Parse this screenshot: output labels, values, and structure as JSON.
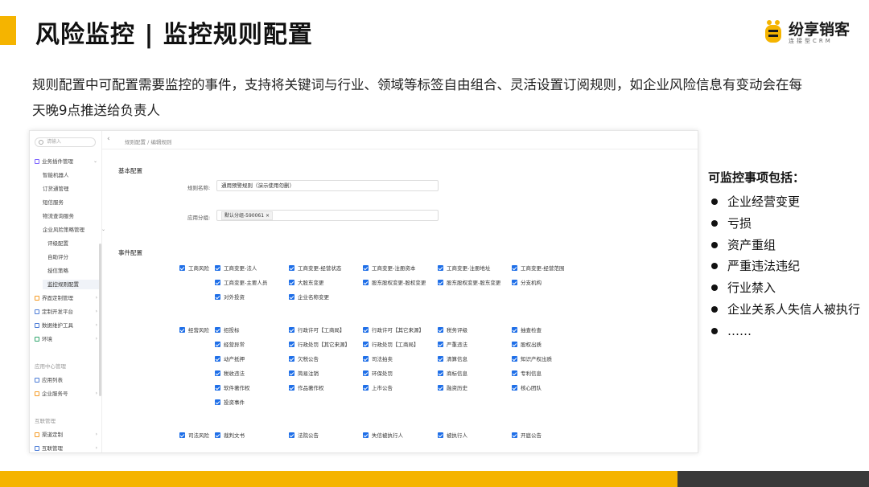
{
  "slide": {
    "title": "风险监控 | 监控规则配置",
    "description": "规则配置中可配置需要监控的事件，支持将关键词与行业、领域等标签自由组合、灵活设置订阅规则，如企业风险信息有变动会在每天晚9点推送给负责人"
  },
  "logo": {
    "name": "纷享销客",
    "sub": "连接型CRM"
  },
  "app": {
    "search_placeholder": "请输入",
    "breadcrumb": "规则配置 / 编辑规则",
    "sidebar": [
      {
        "label": "业务插件管理",
        "icon": "plugin-icon",
        "color": "#7b61ff"
      },
      {
        "label": "智能机器人"
      },
      {
        "label": "订货通管理"
      },
      {
        "label": "短信服务"
      },
      {
        "label": "物流查询服务"
      },
      {
        "label": "企业风险策略管理"
      },
      {
        "label": "评级配置"
      },
      {
        "label": "自助评分"
      },
      {
        "label": "授信策略"
      },
      {
        "label": "监控规则配置"
      },
      {
        "label": "界面定制管理",
        "icon": "layout-icon",
        "color": "#f59a23"
      },
      {
        "label": "定制开发平台",
        "icon": "dev-icon",
        "color": "#4a7bd6"
      },
      {
        "label": "数据维护工具",
        "icon": "chart-icon",
        "color": "#4a7bd6"
      },
      {
        "label": "环境",
        "icon": "env-icon",
        "color": "#2fa56c"
      },
      {
        "label": "应用中心管理"
      },
      {
        "label": "应用列表",
        "icon": "list-icon",
        "color": "#4a7bd6"
      },
      {
        "label": "企业服务号",
        "icon": "service-icon",
        "color": "#f59a23"
      },
      {
        "label": "互联管理"
      },
      {
        "label": "渠道定制",
        "icon": "channel-icon",
        "color": "#f59a23"
      },
      {
        "label": "互联管理",
        "icon": "link-icon",
        "color": "#4a7bd6"
      }
    ],
    "basic": {
      "section": "基本配置",
      "name_label": "规则名称:",
      "name_value": "通用预警规则（演示使用勿删）",
      "group_label": "应用分组:",
      "group_tag": "默认分组-590061 ×"
    },
    "events": {
      "section": "事件配置",
      "groups": [
        {
          "name": "工商风险",
          "items": [
            "工商变更-法人",
            "工商变更-经营状态",
            "工商变更-注册资本",
            "工商变更-注册地址",
            "工商变更-经营范围",
            "工商变更-主要人员",
            "大股东变更",
            "股东股权变更-股权变更",
            "股东股权变更-股东变更",
            "分支机构",
            "对外投资",
            "企业名称变更"
          ]
        },
        {
          "name": "经营风险",
          "items": [
            "招投标",
            "行政许可【工商局】",
            "行政许可【其它来源】",
            "税务评级",
            "抽查检查",
            "经营异常",
            "行政处罚【其它来源】",
            "行政处罚【工商局】",
            "严重违法",
            "股权出质",
            "动产抵押",
            "欠税公告",
            "司法拍卖",
            "清算信息",
            "知识产权出质",
            "税收违法",
            "简易注销",
            "环保处罚",
            "商标信息",
            "专利信息",
            "软件著作权",
            "作品著作权",
            "上市公告",
            "融资历史",
            "核心团队",
            "投资事件"
          ]
        },
        {
          "name": "司法风险",
          "items": [
            "裁判文书",
            "法院公告",
            "失信被执行人",
            "被执行人",
            "开庭公告"
          ]
        }
      ]
    }
  },
  "monitor": {
    "title": "可监控事项包括：",
    "items": [
      "企业经营变更",
      "亏损",
      "资产重组",
      "严重违法违纪",
      "行业禁入",
      "企业关系人失信人被执行",
      "……"
    ]
  },
  "colors": {
    "accent": "#f5b400",
    "checkbox": "#1f6fe8",
    "footer_dark": "#3a3a3a"
  }
}
